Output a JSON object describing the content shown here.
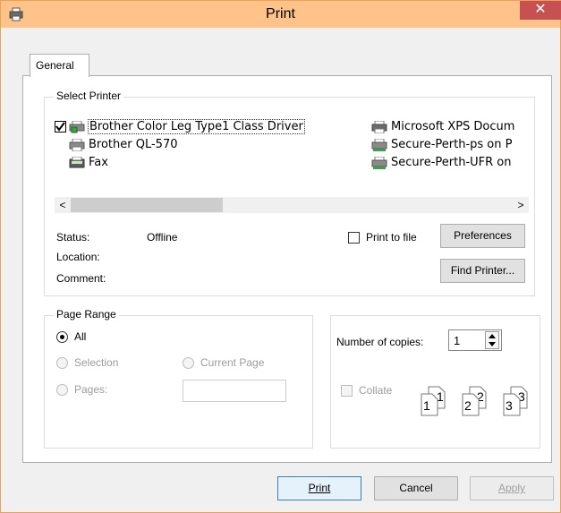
{
  "window": {
    "title": "Print",
    "close_glyph": "✕",
    "accent": "#ffc38a",
    "close_color": "#c75050"
  },
  "tabs": [
    {
      "label": "General"
    }
  ],
  "select_printer": {
    "legend": "Select Printer",
    "printers": [
      {
        "name": "Brother Color Leg Type1 Class Driver",
        "selected": true,
        "icon": "printer-icon"
      },
      {
        "name": "Brother QL-570",
        "icon": "printer-icon"
      },
      {
        "name": "Fax",
        "icon": "fax-icon"
      },
      {
        "name": "Microsoft XPS Docum",
        "icon": "printer-icon"
      },
      {
        "name": "Secure-Perth-ps on P",
        "icon": "network-printer-icon"
      },
      {
        "name": "Secure-Perth-UFR on",
        "icon": "network-printer-icon"
      }
    ],
    "scroll_left": "<",
    "scroll_right": ">",
    "status_label": "Status:",
    "status_value": "Offline",
    "location_label": "Location:",
    "location_value": "",
    "comment_label": "Comment:",
    "comment_value": "",
    "print_to_file_label": "Print to file",
    "preferences_label": "Preferences",
    "find_printer_label": "Find Printer..."
  },
  "page_range": {
    "legend": "Page Range",
    "all_label": "All",
    "selection_label": "Selection",
    "current_page_label": "Current Page",
    "pages_label": "Pages:",
    "selected": "All"
  },
  "copies": {
    "label": "Number of copies:",
    "value": "1",
    "collate_label": "Collate",
    "collate_pages": [
      "1",
      "1",
      "2",
      "2",
      "3",
      "3"
    ]
  },
  "footer": {
    "print_label": "Print",
    "cancel_label": "Cancel",
    "apply_label": "Apply"
  }
}
